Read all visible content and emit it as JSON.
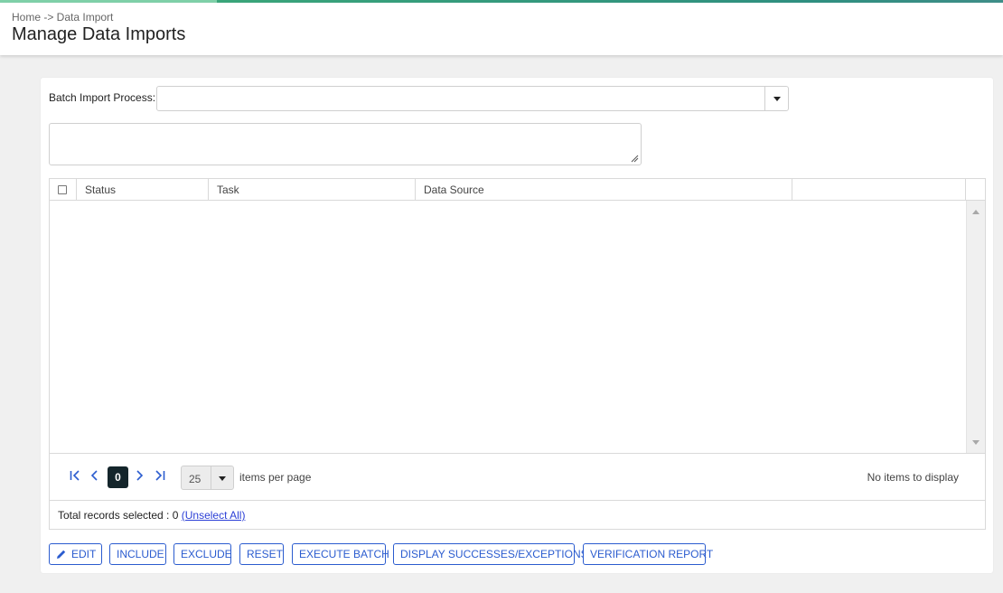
{
  "header": {
    "breadcrumb": "Home -> Data Import",
    "title": "Manage Data Imports"
  },
  "form": {
    "batch_label": "Batch Import Process:",
    "batch_value": "",
    "notes_value": ""
  },
  "grid": {
    "columns": [
      "Status",
      "Task",
      "Data Source",
      ""
    ],
    "rows": []
  },
  "pager": {
    "first": "|<",
    "prev": "<",
    "current_page": "0",
    "next": ">",
    "last": ">|",
    "page_size": "25",
    "items_per_page_label": "items per page",
    "no_items": "No items to display"
  },
  "selection": {
    "label": "Total records selected : 0",
    "unselect": "(Unselect All)"
  },
  "actions": {
    "edit": "EDIT",
    "include": "INCLUDE",
    "exclude": "EXCLUDE",
    "reset": "RESET",
    "execute": "EXECUTE BATCH",
    "display": "DISPLAY SUCCESSES/EXCEPTIONS",
    "verification": "VERIFICATION REPORT"
  },
  "colors": {
    "accent": "#2b5ccf",
    "topbar": "#3aa57a",
    "pager_active": "#14252b"
  }
}
